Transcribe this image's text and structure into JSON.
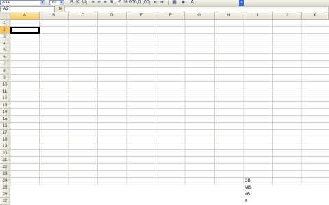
{
  "toolbar": {
    "font_name": "Arial",
    "font_size": "10",
    "dropdown_arrow": "▾",
    "buttons": [
      {
        "name": "bold-button",
        "glyph": "B"
      },
      {
        "name": "italic-button",
        "glyph": "K"
      },
      {
        "name": "underline-button",
        "glyph": "U"
      },
      {
        "name": "align-left-button",
        "glyph": "≡"
      },
      {
        "name": "align-center-button",
        "glyph": "≡"
      },
      {
        "name": "align-right-button",
        "glyph": "≡"
      },
      {
        "name": "merge-center-button",
        "glyph": "⊞"
      },
      {
        "name": "currency-button",
        "glyph": "€"
      },
      {
        "name": "percent-button",
        "glyph": "%"
      },
      {
        "name": "thousands-button",
        "glyph": "000"
      },
      {
        "name": "increase-decimal-button",
        "glyph": ",0"
      },
      {
        "name": "decrease-decimal-button",
        "glyph": ",00"
      },
      {
        "name": "decrease-indent-button",
        "glyph": "⇤"
      },
      {
        "name": "increase-indent-button",
        "glyph": "⇥"
      },
      {
        "name": "borders-button",
        "glyph": "▦"
      },
      {
        "name": "fill-color-button",
        "glyph": "◈"
      },
      {
        "name": "font-color-button",
        "glyph": "A"
      },
      {
        "name": "toolbar-options-button",
        "glyph": "»"
      }
    ]
  },
  "formula_bar": {
    "name_box": "A2",
    "fx_label": "fx",
    "content": ""
  },
  "sheet": {
    "columns": [
      "A",
      "B",
      "C",
      "D",
      "E",
      "F",
      "G",
      "H",
      "I",
      "J",
      "K"
    ],
    "rows": [
      "1",
      "2",
      "3",
      "4",
      "5",
      "6",
      "7",
      "8",
      "9",
      "10",
      "11",
      "12",
      "13",
      "14",
      "15",
      "16",
      "17",
      "18",
      "19",
      "20",
      "21",
      "22",
      "23",
      "24",
      "25",
      "26",
      "27"
    ],
    "active_column": "A",
    "active_row": "2",
    "cells": [
      {
        "ref": "I24",
        "text": "GB"
      },
      {
        "ref": "I25",
        "text": "MB"
      },
      {
        "ref": "I26",
        "text": "KB"
      },
      {
        "ref": "I27",
        "text": "B"
      }
    ]
  },
  "colors": {
    "active_header": "#f7c65d",
    "toolbar_end": "#3a6ccf"
  }
}
